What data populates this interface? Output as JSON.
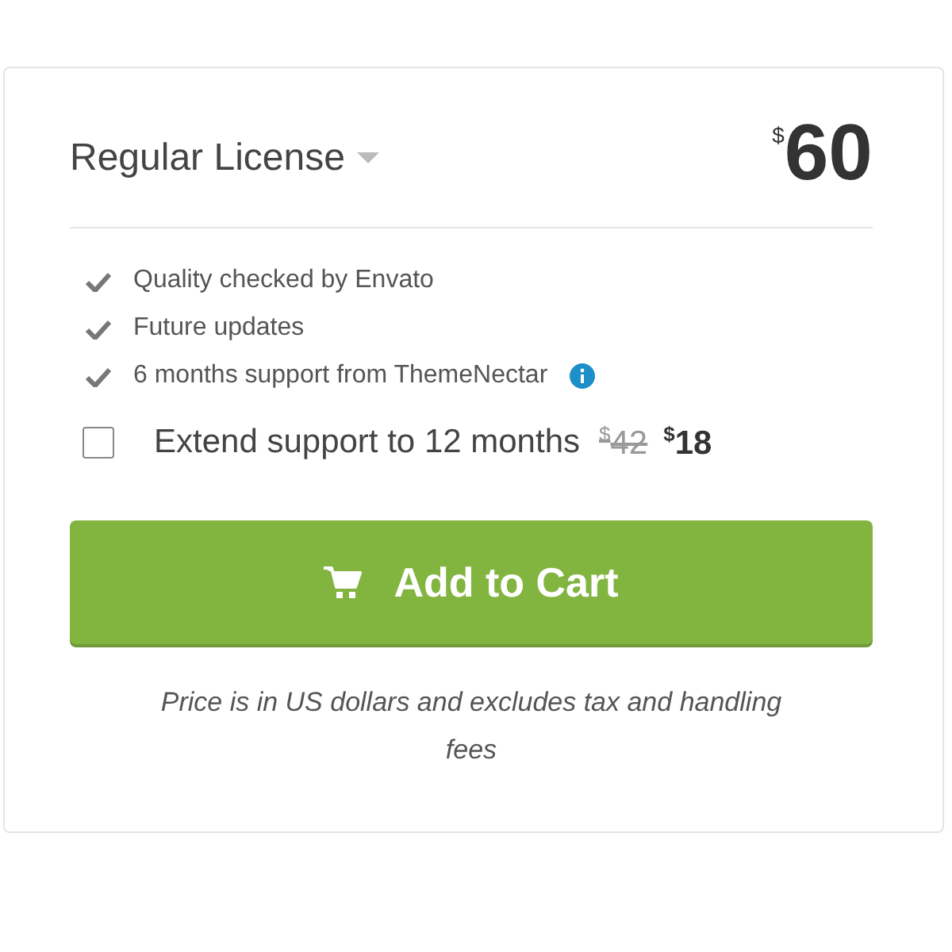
{
  "license": {
    "title": "Regular License",
    "currency": "$",
    "price": "60"
  },
  "features": [
    {
      "text": "Quality checked by Envato"
    },
    {
      "text": "Future updates"
    },
    {
      "text": "6 months support from ThemeNectar",
      "info": true
    }
  ],
  "extend": {
    "label": "Extend support to 12 months",
    "checked": false,
    "old_currency": "$",
    "old_price": "42",
    "currency": "$",
    "price": "18"
  },
  "button": {
    "label": "Add to Cart"
  },
  "note": "Price is in US dollars and excludes tax and handling fees"
}
